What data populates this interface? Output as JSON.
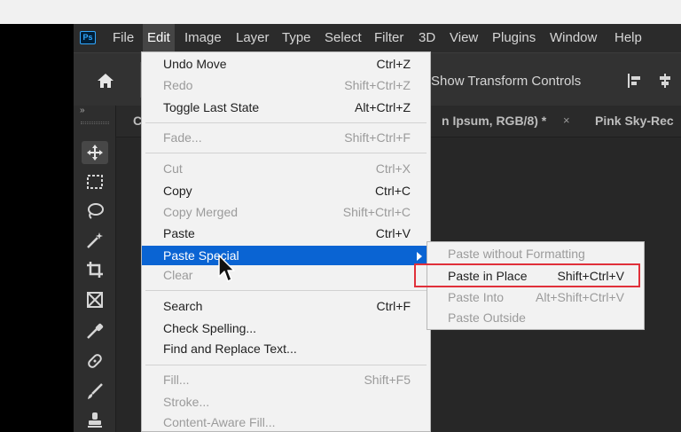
{
  "menubar": {
    "logo": "Ps",
    "items": [
      "File",
      "Edit",
      "Image",
      "Layer",
      "Type",
      "Select",
      "Filter",
      "3D",
      "View",
      "Plugins",
      "Window",
      "Help"
    ],
    "active": "Edit"
  },
  "options_bar": {
    "home_icon": "home-icon",
    "transform_label": "Show Transform Controls",
    "align_icons": [
      "align-left-icon",
      "align-center-icon"
    ]
  },
  "tools_panel": {
    "collapse": "»",
    "tools": [
      "move-tool-icon",
      "marquee-tool-icon",
      "lasso-tool-icon",
      "magic-wand-icon",
      "crop-tool-icon",
      "frame-tool-icon",
      "eyedropper-icon",
      "healing-brush-icon",
      "brush-tool-icon",
      "clone-stamp-icon"
    ]
  },
  "tabs": {
    "left": "C",
    "middle": "n Ipsum, RGB/8) *",
    "close": "×",
    "right": "Pink Sky-Rec"
  },
  "edit_menu": {
    "groups": [
      [
        {
          "label": "Undo Move",
          "shortcut": "Ctrl+Z",
          "enabled": true
        },
        {
          "label": "Redo",
          "shortcut": "Shift+Ctrl+Z",
          "enabled": false
        },
        {
          "label": "Toggle Last State",
          "shortcut": "Alt+Ctrl+Z",
          "enabled": true
        }
      ],
      [
        {
          "label": "Fade...",
          "shortcut": "Shift+Ctrl+F",
          "enabled": false
        }
      ],
      [
        {
          "label": "Cut",
          "shortcut": "Ctrl+X",
          "enabled": false
        },
        {
          "label": "Copy",
          "shortcut": "Ctrl+C",
          "enabled": true
        },
        {
          "label": "Copy Merged",
          "shortcut": "Shift+Ctrl+C",
          "enabled": false
        },
        {
          "label": "Paste",
          "shortcut": "Ctrl+V",
          "enabled": true
        },
        {
          "label": "Paste Special",
          "shortcut": "",
          "enabled": true,
          "highlighted": true
        },
        {
          "label": "Clear",
          "shortcut": "",
          "enabled": false
        }
      ],
      [
        {
          "label": "Search",
          "shortcut": "Ctrl+F",
          "enabled": true
        },
        {
          "label": "Check Spelling...",
          "shortcut": "",
          "enabled": true
        },
        {
          "label": "Find and Replace Text...",
          "shortcut": "",
          "enabled": true
        }
      ],
      [
        {
          "label": "Fill...",
          "shortcut": "Shift+F5",
          "enabled": false
        },
        {
          "label": "Stroke...",
          "shortcut": "",
          "enabled": false
        },
        {
          "label": "Content-Aware Fill...",
          "shortcut": "",
          "enabled": false
        }
      ]
    ]
  },
  "paste_special_submenu": {
    "items": [
      {
        "label": "Paste without Formatting",
        "shortcut": "",
        "enabled": false
      },
      {
        "label": "Paste in Place",
        "shortcut": "Shift+Ctrl+V",
        "enabled": true,
        "outlined": true
      },
      {
        "label": "Paste Into",
        "shortcut": "Alt+Shift+Ctrl+V",
        "enabled": false
      },
      {
        "label": "Paste Outside",
        "shortcut": "",
        "enabled": false
      }
    ],
    "outline_color": "#e0303a"
  },
  "colors": {
    "menubar_bg": "#2b2b2b",
    "menu_bg": "#f2f2f2",
    "highlight": "#0a64d3",
    "disabled_text": "#9b9b9b",
    "ps_blue": "#31a8ff"
  }
}
